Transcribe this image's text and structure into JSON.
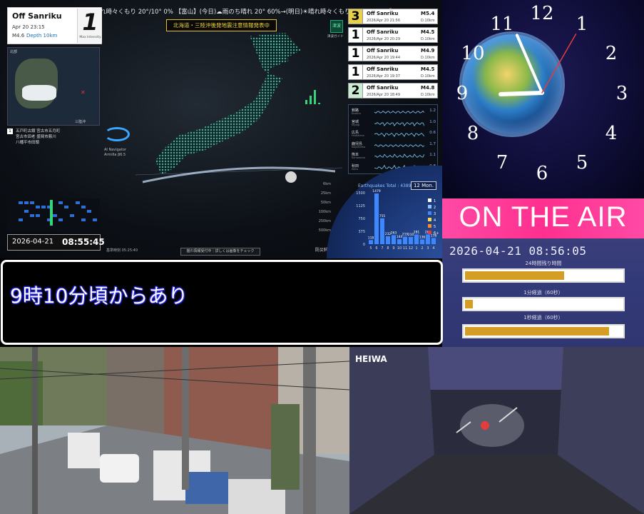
{
  "ticker": "れ時々くもり 20°/10° 0% 【富山】(今日)☁雨のち晴れ 20° 60%→(明日)☀晴れ時々くもり 23°/9° 0% 【",
  "main_quake": {
    "location": "Off Sanriku",
    "datetime": "Apr 20 23:15",
    "magnitude": "M4.6",
    "depth": "Depth 10km",
    "max_intensity": "1",
    "max_intensity_label": "Max Intensity"
  },
  "mini_map": {
    "label_top": "北部",
    "label_bottom": "三陸沖"
  },
  "area_list": {
    "index": "1",
    "lines": [
      "五戸町古舘  宮古市五月町",
      "宮古市田老  盛岡市薮川",
      "八幡平市田頭"
    ]
  },
  "ai": {
    "name": "AI Navigator",
    "model": "Armilla β6.5"
  },
  "alert_banner": "北海道・三陸沖後発地震注意情報発表中",
  "tsunami": {
    "icon": "津波",
    "label": "津波ガイド"
  },
  "clock_box": {
    "date": "2026-04-21",
    "time": "08:55:45"
  },
  "base_time": "基準時刻 05:25:40",
  "status_button": "揺れ情報受付中｜詳しくは画像をチェック",
  "nied": "防災科研",
  "eq_list": [
    {
      "intensity": "3",
      "name": "Off Sanriku",
      "datetime": "2026/Apr 20 21:56",
      "mag": "M5.4",
      "depth": "D.10km"
    },
    {
      "intensity": "1",
      "name": "Off Sanriku",
      "datetime": "2026/Apr 20 20:29",
      "mag": "M4.5",
      "depth": "D.10km"
    },
    {
      "intensity": "1",
      "name": "Off Sanriku",
      "datetime": "2026/Apr 20 19:44",
      "mag": "M4.9",
      "depth": "D.10km"
    },
    {
      "intensity": "1",
      "name": "Off Sanriku",
      "datetime": "2026/Apr 20 19:37",
      "mag": "M4.5",
      "depth": "D.10km"
    },
    {
      "intensity": "2",
      "name": "Off Sanriku",
      "datetime": "2026/Apr 20 18:49",
      "mag": "M4.8",
      "depth": "D.10km"
    }
  ],
  "waveforms": [
    {
      "name": "釧路",
      "en": "Kushiro",
      "value": "1.2"
    },
    {
      "name": "宮城",
      "en": "Miyagi",
      "value": "1.0"
    },
    {
      "name": "広島",
      "en": "Hiroshima",
      "value": "0.6"
    },
    {
      "name": "鹿児島",
      "en": "Kagoshima",
      "value": "1.7"
    },
    {
      "name": "熊本",
      "en": "Kumamoto",
      "value": "1.1"
    },
    {
      "name": "秋田",
      "en": "Akita",
      "value": "0.8"
    }
  ],
  "eq_stats": {
    "title": "Earthquakes",
    "total_label": "Total : 4389",
    "period": "12 Mon.",
    "legend": [
      "1",
      "2",
      "3",
      "4",
      "5",
      "6+"
    ]
  },
  "chart_data": {
    "type": "bar",
    "categories": [
      "5",
      "6",
      "7",
      "8",
      "9",
      "10",
      "11",
      "12",
      "1",
      "2",
      "3",
      "4"
    ],
    "values": [
      118,
      1479,
      755,
      232,
      263,
      144,
      219,
      210,
      281,
      136,
      284,
      178
    ],
    "ylim": [
      0,
      1500
    ],
    "yticks": [
      0,
      375,
      750,
      1125,
      1500
    ]
  },
  "depth_scale": [
    "6km",
    "25km",
    "50km",
    "100km",
    "250km",
    "500km"
  ],
  "clock": {
    "hour_numerals": [
      "12",
      "1",
      "2",
      "3",
      "4",
      "5",
      "6",
      "7",
      "8",
      "9",
      "10",
      "11"
    ],
    "time": "08:56:05"
  },
  "on_air": {
    "text": "ON THE AIR",
    "datetime": "2026-04-21 08:56:05"
  },
  "progress": [
    {
      "label": "24時間残り時間",
      "fraction": 0.63
    },
    {
      "label": "1分経過（60秒）",
      "fraction": 0.05
    },
    {
      "label": "1秒経過（60秒）",
      "fraction": 0.92
    }
  ],
  "subtitle": "9時10分頃からあり",
  "game_logo": "HEIWA",
  "colors": {
    "accent_pink": "#ff2f8e",
    "intensity3": "#e8d14a",
    "intensity2": "#c9ecd3",
    "progress_fill": "#d49e26",
    "alert_yellow": "#f2d235"
  }
}
